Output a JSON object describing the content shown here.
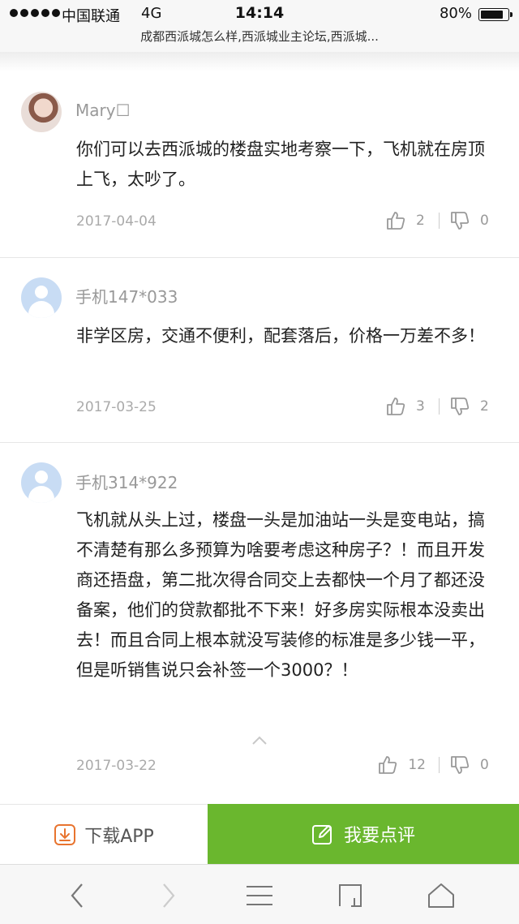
{
  "status_bar": {
    "carrier": "中国联通",
    "network": "4G",
    "time": "14:14",
    "battery": "80%",
    "battery_level": 0.8
  },
  "page": {
    "title": "成都西派城怎么样,西派城业主论坛,西派城..."
  },
  "comments": [
    {
      "username": "Mary☐",
      "content": "你们可以去西派城的楼盘实地考察一下，飞机就在房顶上飞，太吵了。",
      "date": "2017-04-04",
      "likes": "2",
      "dislikes": "0"
    },
    {
      "username": "手机147*033",
      "content": "非学区房，交通不便利，配套落后，价格一万差不多！",
      "date": "2017-03-25",
      "likes": "3",
      "dislikes": "2"
    },
    {
      "username": "手机314*922",
      "content": "飞机就从头上过，楼盘一头是加油站一头是变电站，搞不清楚有那么多预算为啥要考虑这种房子？！而且开发商还捂盘，第二批次得合同交上去都快一个月了都还没备案，他们的贷款都批不下来！好多房实际根本没卖出去！而且合同上根本就没写装修的标准是多少钱一平，但是听销售说只会补签一个3000？！",
      "date": "2017-03-22",
      "likes": "12",
      "dislikes": "0"
    }
  ],
  "bottom_actions": {
    "download_label": "下载APP",
    "review_label": "我要点评"
  },
  "colors": {
    "accent_green": "#6ab72e",
    "download_orange": "#e8742f"
  }
}
